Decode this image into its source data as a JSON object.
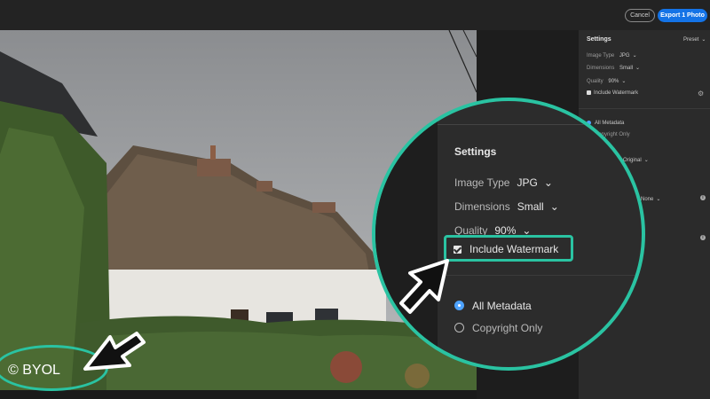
{
  "topbar": {
    "cancel_label": "Cancel",
    "export_label": "Export 1 Photo"
  },
  "settings_panel": {
    "title": "Settings",
    "preset_label": "Preset",
    "image_type_label": "Image Type",
    "image_type_value": "JPG",
    "dimensions_label": "Dimensions",
    "dimensions_value": "Small",
    "quality_label": "Quality",
    "quality_value": "90%",
    "watermark_label": "Include Watermark",
    "all_metadata_label": "All Metadata",
    "copyright_only_label": "Copyright Only",
    "original_value": "Original",
    "none_value": "None"
  },
  "magnifier": {
    "title": "Settings",
    "image_type_label": "Image Type",
    "image_type_value": "JPG",
    "dimensions_label": "Dimensions",
    "dimensions_value": "Small",
    "quality_label": "Quality",
    "quality_value": "90%",
    "watermark_label": "Include Watermark",
    "watermark_checked": true,
    "all_metadata_label": "All Metadata",
    "copyright_only_label": "Copyright Only"
  },
  "watermark_overlay": {
    "text": "© BYOL"
  },
  "colors": {
    "accent": "#2ac3a2",
    "export_button": "#1473e6",
    "radio_selected": "#4ea3ff"
  },
  "icons": [
    "cursor-arrow-icon",
    "chevron-down-icon",
    "gear-icon",
    "info-icon"
  ]
}
